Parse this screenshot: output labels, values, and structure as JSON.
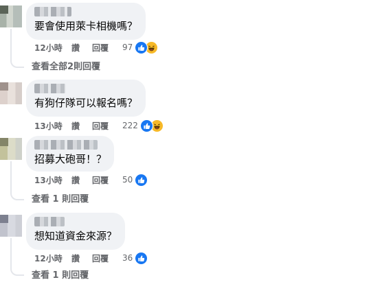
{
  "comments": [
    {
      "text": "要會使用萊卡相機嗎？",
      "time": "12小時",
      "like": "讚",
      "reply": "回覆",
      "reactions": "97",
      "view_replies": "查看全部2則回覆"
    },
    {
      "text": "有狗仔隊可以報名嗎？",
      "time": "13小時",
      "like": "讚",
      "reply": "回覆",
      "reactions": "222"
    },
    {
      "text": "招募大砲哥！？",
      "time": "13小時",
      "like": "讚",
      "reply": "回覆",
      "reactions": "50",
      "view_replies": "查看 1 則回覆"
    },
    {
      "text": "想知道資金來源？",
      "time": "12小時",
      "like": "讚",
      "reply": "回覆",
      "reactions": "36",
      "view_replies": "查看 1 則回覆"
    }
  ],
  "colors": {
    "like_blue": "#1877f2",
    "haha_yellow": "#f7b928",
    "bubble_bg": "#f0f2f5",
    "meta_gray": "#65676b"
  },
  "icons": [
    "like-icon",
    "haha-icon"
  ]
}
